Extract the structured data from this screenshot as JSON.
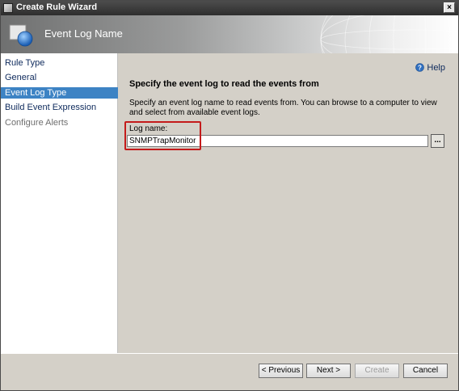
{
  "window": {
    "title": "Create Rule Wizard",
    "close_glyph": "×"
  },
  "banner": {
    "title": "Event Log Name"
  },
  "sidebar": {
    "items": [
      {
        "label": "Rule Type",
        "state": "normal"
      },
      {
        "label": "General",
        "state": "normal"
      },
      {
        "label": "Event Log Type",
        "state": "active"
      },
      {
        "label": "Build Event Expression",
        "state": "normal"
      },
      {
        "label": "Configure Alerts",
        "state": "disabled"
      }
    ]
  },
  "content": {
    "help_label": "Help",
    "heading": "Specify the event log to read the events from",
    "description": "Specify an event log name to read events from. You can browse to a computer to view and select from available event logs.",
    "log_name_label": "Log name:",
    "log_name_value": "SNMPTrapMonitor",
    "browse_label": "..."
  },
  "footer": {
    "previous_label": "< Previous",
    "next_label": "Next >",
    "create_label": "Create",
    "cancel_label": "Cancel"
  },
  "colors": {
    "active_item_bg": "#3d83c4",
    "highlight_border": "#c41b1b",
    "link_text": "#0e2a5c"
  },
  "icons": {
    "title": "wizard-app-icon",
    "banner": "globe-orb-icon",
    "help": "help-question-icon",
    "close": "close-icon"
  }
}
